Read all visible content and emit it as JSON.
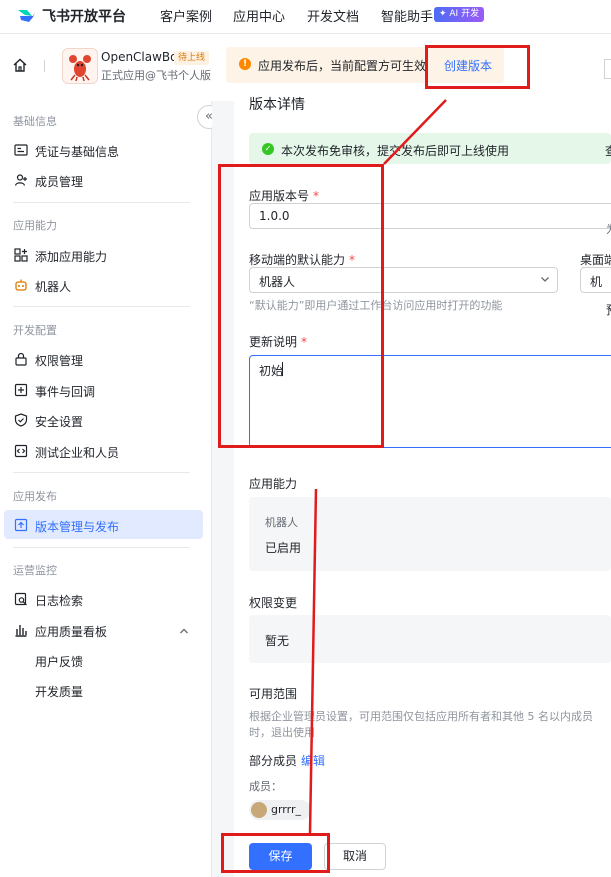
{
  "topbar": {
    "brand": "飞书开放平台",
    "nav": [
      "客户案例",
      "应用中心",
      "开发文档",
      "智能助手"
    ],
    "ai_badge": "✦ AI 开发"
  },
  "app": {
    "name": "OpenClawBot",
    "status": "待上线",
    "subtitle": "正式应用@飞书个人版"
  },
  "notice": {
    "text": "应用发布后，当前配置方可生效",
    "link": "创建版本"
  },
  "sidebar": {
    "sections": [
      {
        "title": "基础信息",
        "items": [
          "凭证与基础信息",
          "成员管理"
        ]
      },
      {
        "title": "应用能力",
        "items": [
          "添加应用能力",
          "机器人"
        ]
      },
      {
        "title": "开发配置",
        "items": [
          "权限管理",
          "事件与回调",
          "安全设置",
          "测试企业和人员"
        ]
      },
      {
        "title": "应用发布",
        "items": [
          "版本管理与发布"
        ]
      },
      {
        "title": "运营监控",
        "items": [
          "日志检索",
          "应用质量看板"
        ]
      }
    ],
    "sub_items": [
      "用户反馈",
      "开发质量"
    ],
    "collapse": "«"
  },
  "main": {
    "title": "版本详情",
    "success_text": "本次发布免审核，提交发布后即可上线使用",
    "edge_text_1": "查",
    "version_label": "应用版本号",
    "version_value": "1.0.0",
    "edge_text_2": "为",
    "mobile_label": "移动端的默认能力",
    "mobile_value": "机器人",
    "desktop_label": "桌面端",
    "desktop_value": "机",
    "hint": "“默认能力”即用户通过工作台访问应用时打开的功能",
    "edge_text_3": "预",
    "notes_label": "更新说明",
    "notes_value": "初始",
    "required_mark": "*",
    "capability_label": "应用能力",
    "capability_name": "机器人",
    "capability_status": "已启用",
    "perm_label": "权限变更",
    "perm_value": "暂无",
    "scope_label": "可用范围",
    "scope_desc": "根据企业管理员设置，可用范围仅包括应用所有者和其他 5 名以内成员时，退出使用",
    "scope_value": "部分成员",
    "edit_link": "编辑",
    "members_label": "成员：",
    "member_name": "grrrr_",
    "save": "保存",
    "cancel": "取消"
  },
  "colors": {
    "accent": "#3370ff",
    "annotation": "#e01b1b",
    "success_bg": "#e4f7e9",
    "warning_bg": "#fdf3e6"
  }
}
